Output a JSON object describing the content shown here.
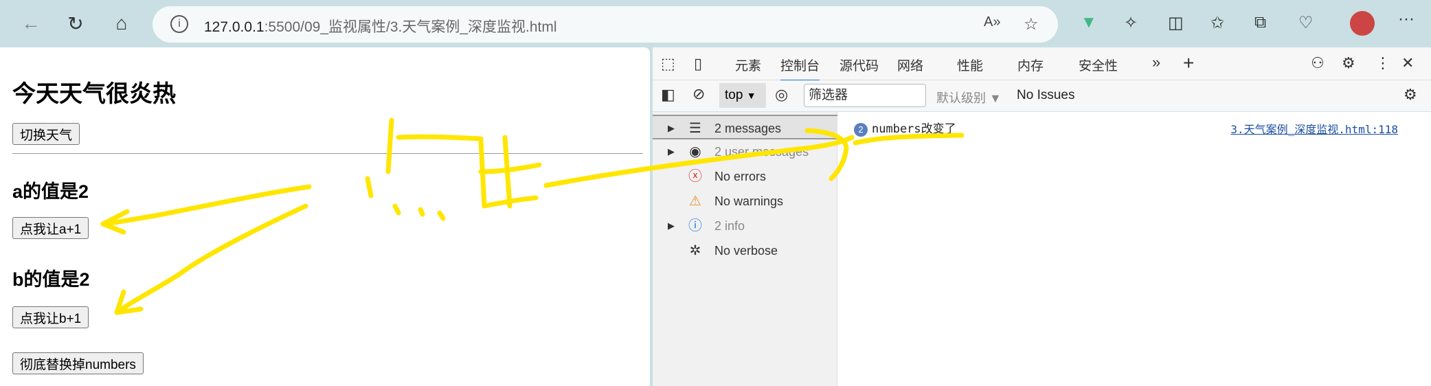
{
  "browser": {
    "url_host": "127.0.0.1",
    "url_rest": ":5500/09_监视属性/3.天气案例_深度监视.html",
    "icons": [
      "back-icon",
      "refresh-icon",
      "home-icon",
      "info-icon",
      "read-aloud-icon",
      "favorite-icon",
      "vue-devtools-icon",
      "extensions-icon",
      "split-screen-icon",
      "favorites-icon",
      "collections-icon",
      "performance-icon",
      "profile-avatar",
      "more-icon"
    ],
    "back": "←",
    "refresh": "↻",
    "home": "⌂",
    "read_aloud": "A»",
    "star": "☆",
    "more": "···"
  },
  "page": {
    "title": "今天天气很炎热",
    "switch_button": "切换天气",
    "a_label": "a的值是2",
    "a_button": "点我让a+1",
    "b_label": "b的值是2",
    "b_button": "点我让b+1",
    "replace_button": "彻底替换掉numbers"
  },
  "devtools": {
    "tabs": [
      "元素",
      "控制台",
      "源代码",
      "网络",
      "性能",
      "内存",
      "安全性"
    ],
    "active_tab": "控制台",
    "context": "top",
    "filter_placeholder": "筛选器",
    "level": "默认级别 ▼",
    "issues": "No Issues",
    "sidebar": [
      {
        "label": "2 messages",
        "icon": "list-icon",
        "expandable": true
      },
      {
        "label": "2 user messages",
        "icon": "user-icon",
        "expandable": true
      },
      {
        "label": "No errors",
        "icon": "error-icon",
        "expandable": false
      },
      {
        "label": "No warnings",
        "icon": "warning-icon",
        "expandable": false
      },
      {
        "label": "2 info",
        "icon": "info-icon",
        "expandable": true
      },
      {
        "label": "No verbose",
        "icon": "bug-icon",
        "expandable": false
      }
    ],
    "messages": [
      {
        "count": "2",
        "text": "numbers改变了",
        "source": "3.天气案例_深度监视.html:118"
      }
    ]
  },
  "annotation": {
    "text": "点击",
    "color": "#ffe600"
  }
}
